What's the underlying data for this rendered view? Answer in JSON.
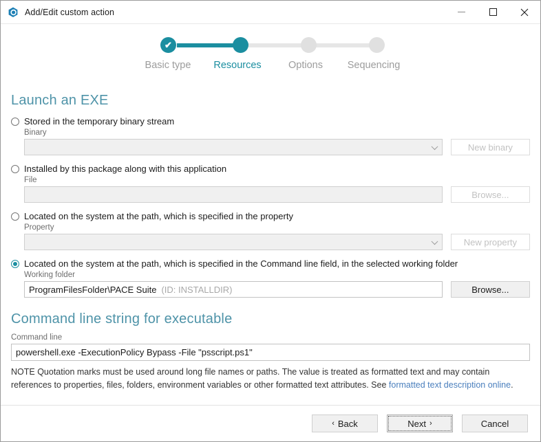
{
  "window": {
    "title": "Add/Edit custom action",
    "icon": "app-logo-icon",
    "controls": {
      "minimize": "minimize-icon",
      "maximize": "maximize-icon",
      "close": "close-icon"
    }
  },
  "stepper": {
    "steps": [
      {
        "label": "Basic type",
        "state": "done"
      },
      {
        "label": "Resources",
        "state": "active"
      },
      {
        "label": "Options",
        "state": "pending"
      },
      {
        "label": "Sequencing",
        "state": "pending"
      }
    ],
    "check_glyph": "✔",
    "accent_color": "#1b8ea0",
    "inactive_color": "#e0e0e0"
  },
  "sections": {
    "launch": {
      "title": "Launch an EXE",
      "options": [
        {
          "label": "Stored in the temporary binary stream",
          "selected": false,
          "field_label": "Binary",
          "field_value": "",
          "field_kind": "combo",
          "button": "New binary",
          "button_enabled": false
        },
        {
          "label": "Installed by this package along with this application",
          "selected": false,
          "field_label": "File",
          "field_value": "",
          "field_kind": "text",
          "button": "Browse...",
          "button_enabled": false
        },
        {
          "label": "Located on the system at the path, which is specified in the property",
          "selected": false,
          "field_label": "Property",
          "field_value": "",
          "field_kind": "combo",
          "button": "New property",
          "button_enabled": false
        },
        {
          "label": "Located on the system at the path, which is specified in the Command line field, in the selected working folder",
          "selected": true,
          "field_label": "Working folder",
          "field_value": "ProgramFilesFolder\\PACE Suite",
          "field_hint": "(ID: INSTALLDIR)",
          "field_kind": "text",
          "button": "Browse...",
          "button_enabled": true
        }
      ]
    },
    "command": {
      "title": "Command line string for executable",
      "field_label": "Command line",
      "field_value": "powershell.exe -ExecutionPolicy Bypass -File \"psscript.ps1\"",
      "note_part1": "NOTE Quotation marks must be used around long file names or paths. The value is treated as formatted text and may contain references to properties, files, folders, environment variables or other formatted text attributes. See ",
      "note_link": "formatted text description online",
      "note_part2": "."
    }
  },
  "footer": {
    "back": "Back",
    "back_arrow": "‹",
    "next": "Next",
    "next_arrow": "›",
    "cancel": "Cancel"
  }
}
